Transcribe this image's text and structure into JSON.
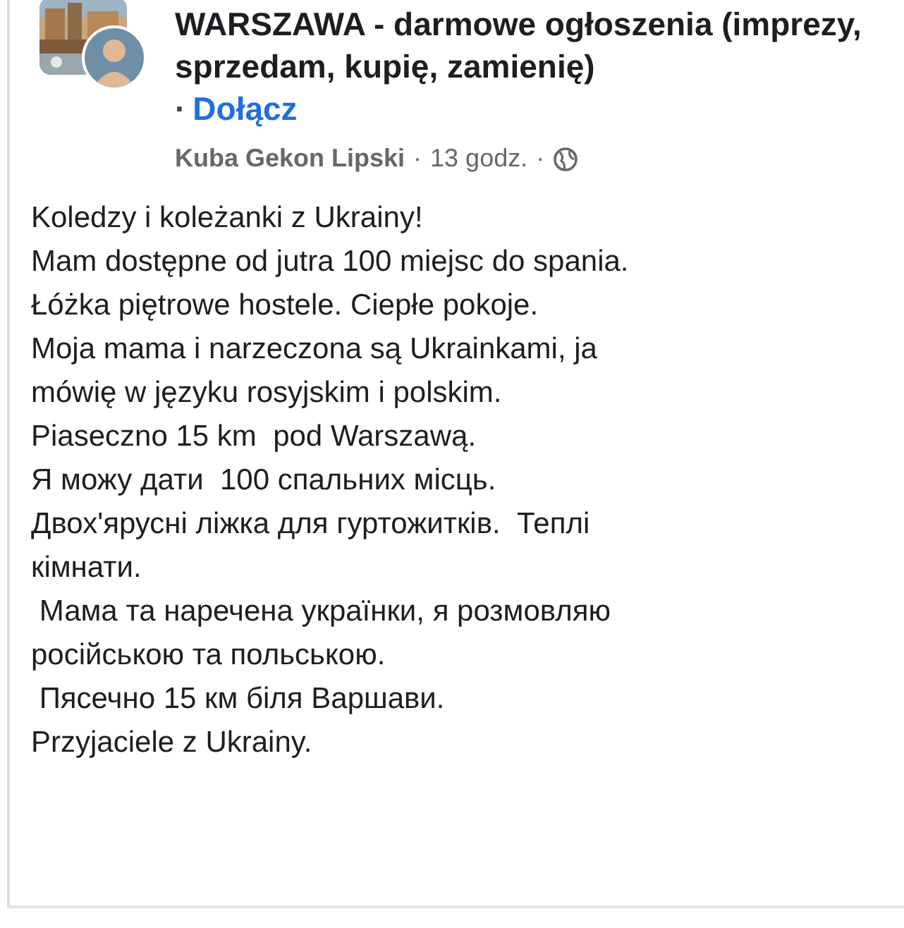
{
  "group": {
    "name": "WARSZAWA - darmowe ogłoszenia (imprezy, sprzedam, kupię, zamienię)",
    "separator": "·",
    "join_link": "Dołącz"
  },
  "meta": {
    "author": "Kuba Gekon Lipski",
    "separator_1": "·",
    "time": "13 godz.",
    "separator_2": "·"
  },
  "body": [
    "Koledzy i koleżanki z Ukrainy!",
    "Mam dostępne od jutra 100 miejsc do spania.",
    "Łóżka piętrowe hostele. Ciepłe pokoje.",
    "Moja mama i narzeczona są Ukrainkami, ja",
    "mówię w języku rosyjskim i polskim.",
    "Piaseczno 15 km  pod Warszawą.",
    "Я можу дати  100 спальних місць.",
    "Двох'ярусні ліжка для гуртожитків.  Теплі",
    "кімнати.",
    " Мама та наречена українки, я розмовляю",
    "російською та польською.",
    " Пясечно 15 км біля Варшави.",
    "Przyjaciele z Ukrainy."
  ]
}
